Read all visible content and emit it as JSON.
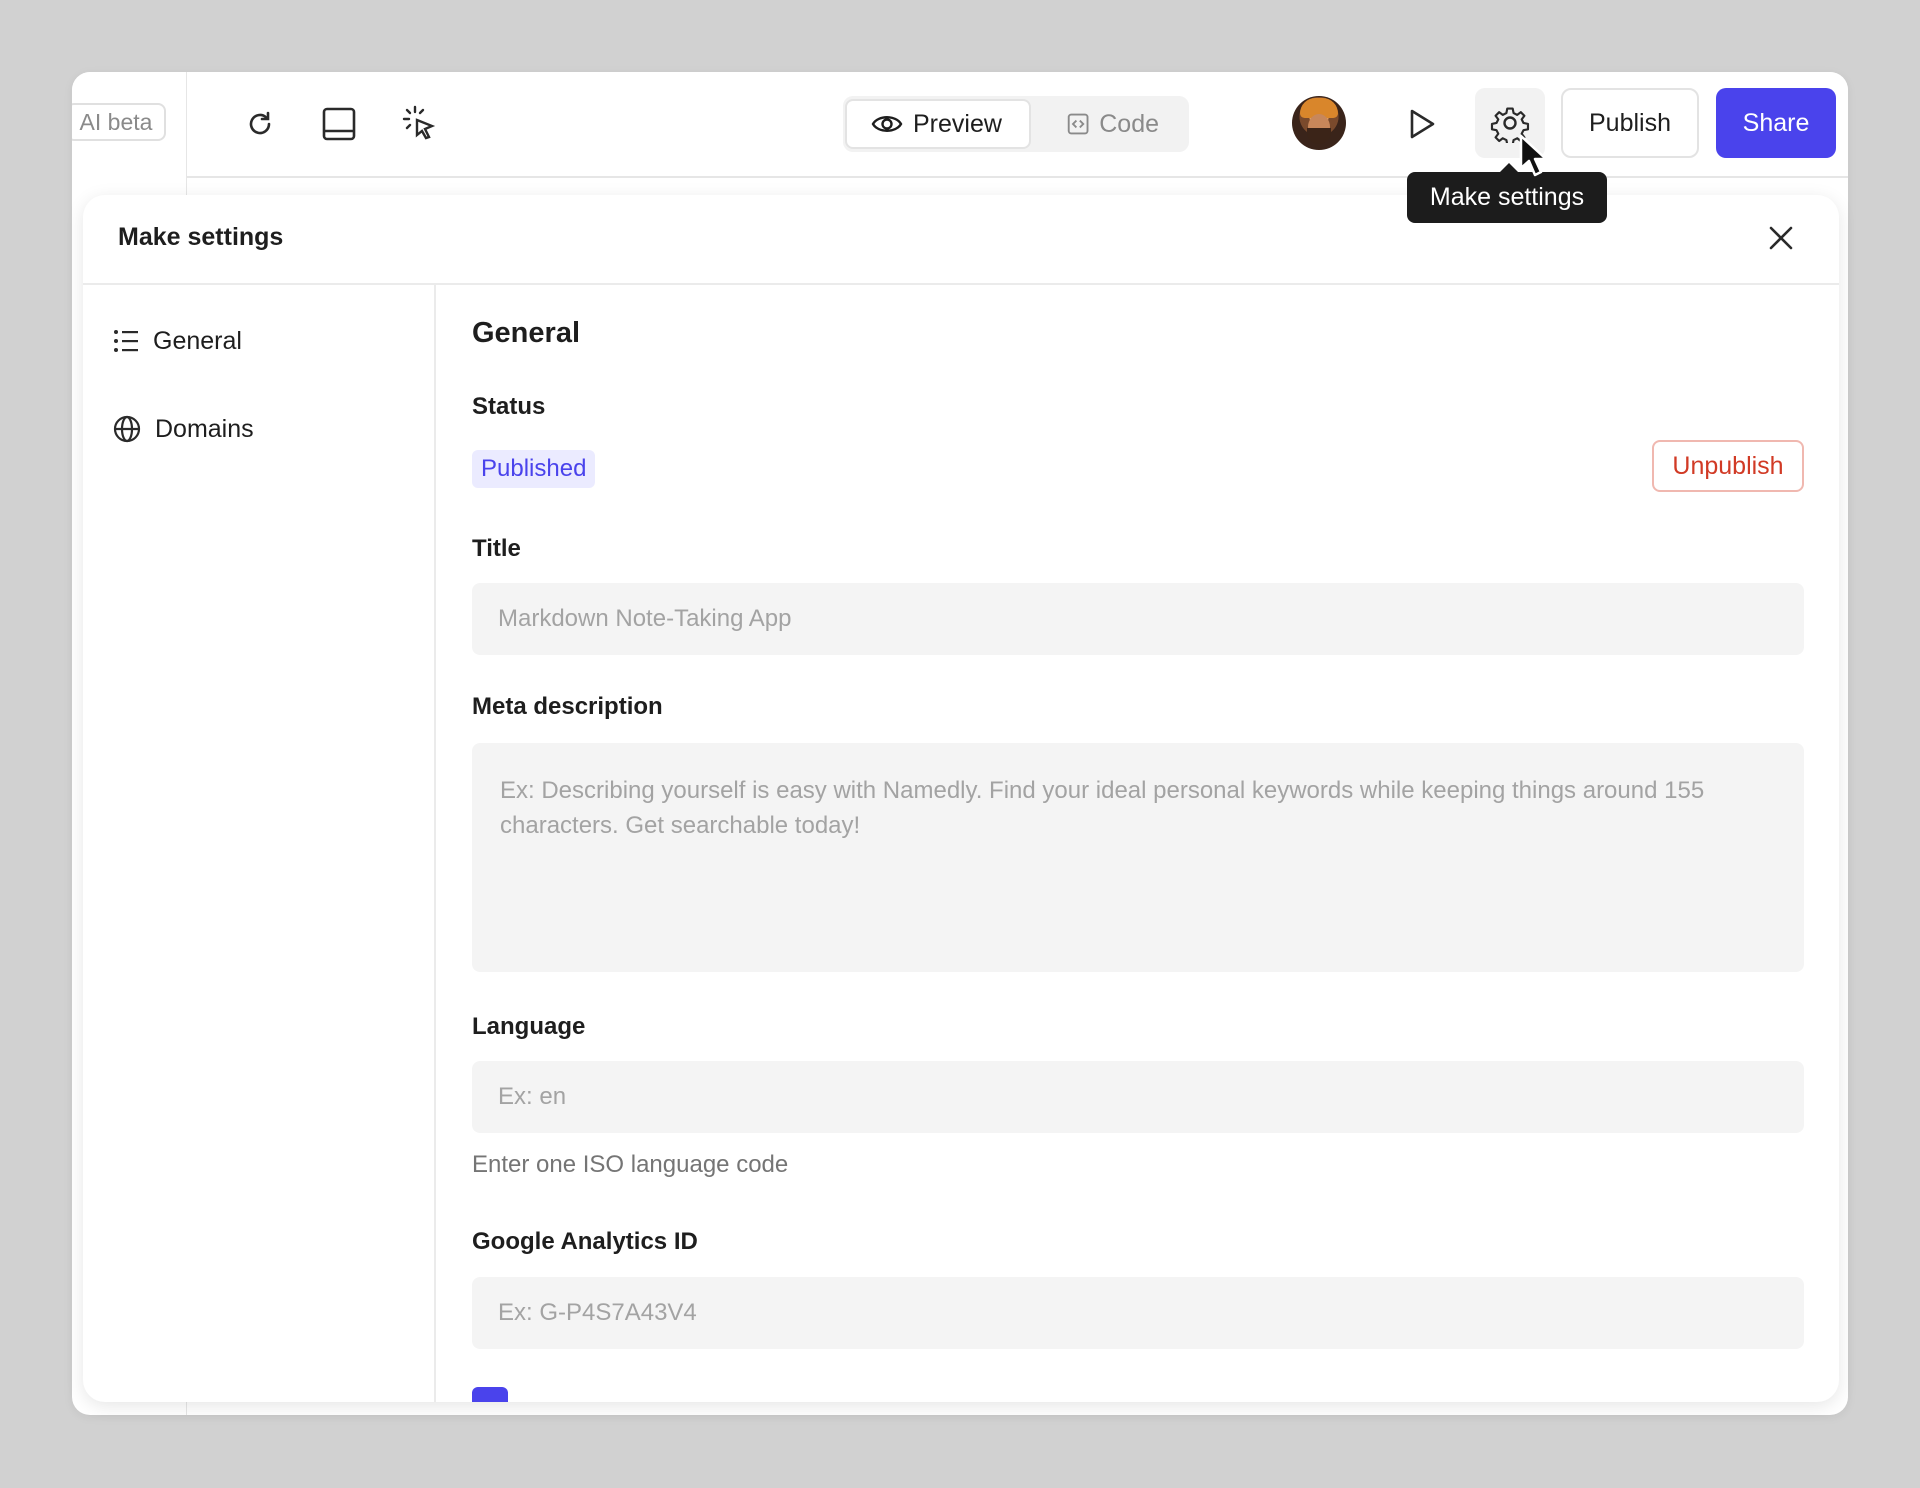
{
  "toolbar": {
    "ai_badge": "AI beta",
    "preview_label": "Preview",
    "code_label": "Code",
    "publish_label": "Publish",
    "share_label": "Share",
    "tooltip": "Make settings",
    "share_color": "#4a43ec"
  },
  "modal": {
    "title": "Make settings",
    "sidebar": {
      "items": [
        {
          "label": "General",
          "icon": "list-icon"
        },
        {
          "label": "Domains",
          "icon": "globe-icon"
        }
      ]
    },
    "general": {
      "heading": "General",
      "status_label": "Status",
      "status_badge": "Published",
      "unpublish_label": "Unpublish",
      "title_label": "Title",
      "title_placeholder": "Markdown Note-Taking App",
      "meta_label": "Meta description",
      "meta_placeholder": "Ex: Describing yourself is easy with Namedly. Find your ideal personal keywords while keeping things around 155 characters. Get searchable today!",
      "language_label": "Language",
      "language_placeholder": "Ex: en",
      "language_hint": "Enter one ISO language code",
      "ga_label": "Google Analytics ID",
      "ga_placeholder": "Ex: G-P4S7A43V4",
      "checkbox_checked": true
    }
  }
}
